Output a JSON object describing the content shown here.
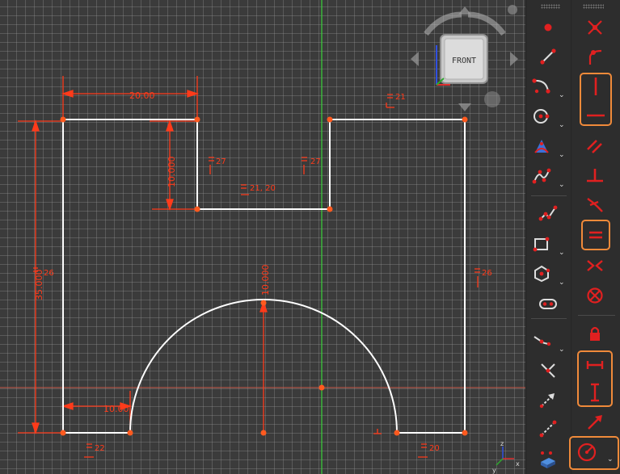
{
  "navcube": {
    "face_label": "FRONT",
    "axis_colors": {
      "x": "#e03030",
      "y": "#2ea82e",
      "z": "#3050e0"
    }
  },
  "colors": {
    "background": "#3b3b3b",
    "grid": "#969696",
    "geometry": "#ffffff",
    "constraint": "#ff3b1a",
    "vertical_axis": "#3ad13a",
    "horizontal_axis": "#c85a4a",
    "toolbar_bg": "#2d2d2d",
    "highlight": "#f08a3a"
  },
  "sketch": {
    "dimensions": {
      "d1": "20.00",
      "d2": "10.000",
      "d3": "35.000",
      "d4": "10.000",
      "d5": "10.00"
    },
    "constraint_labels": {
      "c21": "21",
      "c27a": "27",
      "c27b": "27",
      "c2120": "21, 20",
      "c26a": "26",
      "c26b": "26",
      "c22": "22",
      "c20": "20"
    }
  },
  "axis_triad": {
    "x": "x",
    "y": "y",
    "z": "z"
  },
  "toolbar_left": {
    "items": [
      {
        "name": "point",
        "icon": "point-icon",
        "dropdown": false
      },
      {
        "name": "line",
        "icon": "line-icon",
        "dropdown": false
      },
      {
        "name": "arc",
        "icon": "arc-icon",
        "dropdown": true
      },
      {
        "name": "circle",
        "icon": "circle-icon",
        "dropdown": true
      },
      {
        "name": "conic",
        "icon": "conic-icon",
        "dropdown": true
      },
      {
        "name": "bspline",
        "icon": "bspline-icon",
        "dropdown": true
      },
      {
        "name": "polyline",
        "icon": "polyline-icon",
        "dropdown": false
      },
      {
        "name": "rectangle",
        "icon": "rectangle-icon",
        "dropdown": true
      },
      {
        "name": "polygon",
        "icon": "polygon-icon",
        "dropdown": true
      },
      {
        "name": "slot",
        "icon": "slot-icon",
        "dropdown": false
      },
      {
        "name": "fillet",
        "icon": "fillet-icon",
        "dropdown": true
      },
      {
        "name": "trim",
        "icon": "trim-icon",
        "dropdown": false
      },
      {
        "name": "extend",
        "icon": "extend-icon",
        "dropdown": false
      },
      {
        "name": "external-geometry",
        "icon": "external-geometry-icon",
        "dropdown": false
      },
      {
        "name": "carbon-copy",
        "icon": "carbon-copy-icon",
        "dropdown": false
      }
    ]
  },
  "toolbar_right": {
    "items": [
      {
        "name": "coincident",
        "icon": "coincident-constraint-icon"
      },
      {
        "name": "point-on-object",
        "icon": "point-on-object-constraint-icon"
      },
      {
        "name": "vertical",
        "icon": "vertical-constraint-icon"
      },
      {
        "name": "horizontal",
        "icon": "horizontal-constraint-icon"
      },
      {
        "name": "parallel",
        "icon": "parallel-constraint-icon"
      },
      {
        "name": "perpendicular",
        "icon": "perpendicular-constraint-icon"
      },
      {
        "name": "tangent",
        "icon": "tangent-constraint-icon"
      },
      {
        "name": "equal",
        "icon": "equal-constraint-icon"
      },
      {
        "name": "symmetric",
        "icon": "symmetric-constraint-icon"
      },
      {
        "name": "block",
        "icon": "block-constraint-icon"
      },
      {
        "name": "lock",
        "icon": "lock-constraint-icon"
      },
      {
        "name": "horizontal-distance",
        "icon": "horizontal-distance-icon"
      },
      {
        "name": "vertical-distance",
        "icon": "vertical-distance-icon"
      },
      {
        "name": "distance",
        "icon": "distance-constraint-icon"
      },
      {
        "name": "radius",
        "icon": "radius-constraint-icon",
        "dropdown": true
      }
    ]
  }
}
